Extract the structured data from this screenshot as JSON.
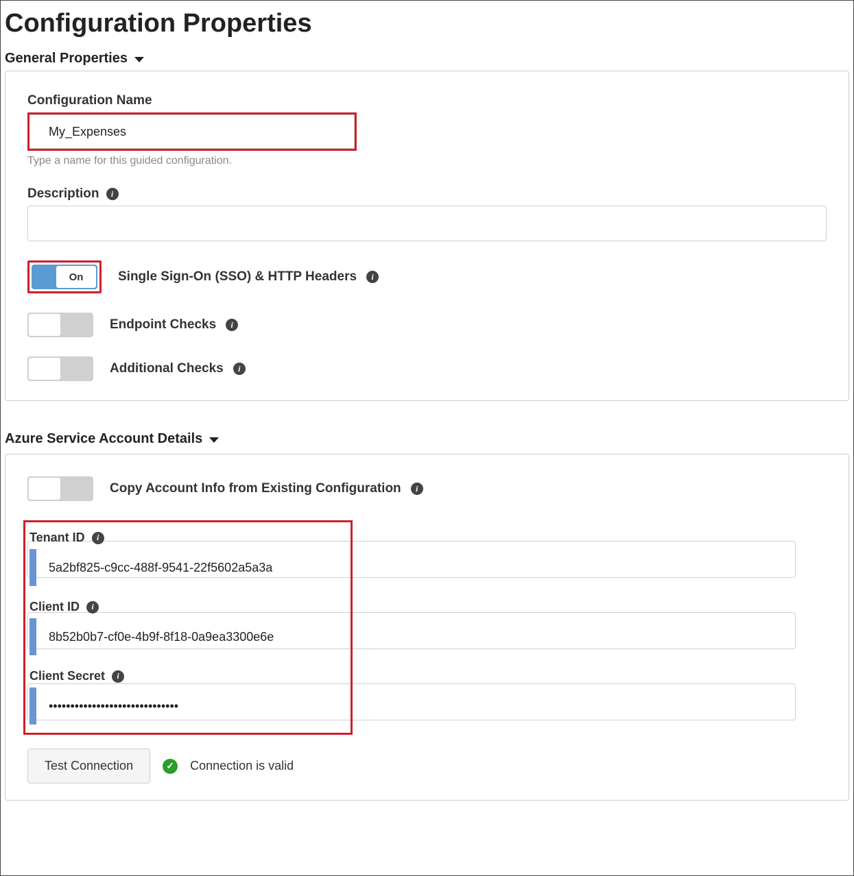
{
  "page_title": "Configuration Properties",
  "sections": {
    "general": {
      "header": "General Properties",
      "configuration_name": {
        "label": "Configuration Name",
        "value": "My_Expenses",
        "helper": "Type a name for this guided configuration."
      },
      "description": {
        "label": "Description",
        "value": ""
      },
      "toggles": {
        "sso": {
          "label": "Single Sign-On (SSO) & HTTP Headers",
          "state": "On",
          "on": true
        },
        "endpoint": {
          "label": "Endpoint Checks",
          "on": false
        },
        "additional": {
          "label": "Additional Checks",
          "on": false
        }
      }
    },
    "azure": {
      "header": "Azure Service Account Details",
      "copy_account": {
        "label": "Copy Account Info from Existing Configuration",
        "on": false
      },
      "tenant_id": {
        "label": "Tenant ID",
        "value": "5a2bf825-c9cc-488f-9541-22f5602a5a3a"
      },
      "client_id": {
        "label": "Client ID",
        "value": "8b52b0b7-cf0e-4b9f-8f18-0a9ea3300e6e"
      },
      "client_secret": {
        "label": "Client Secret",
        "value": "••••••••••••••••••••••••••••••"
      },
      "test_connection": {
        "button": "Test Connection",
        "status": "Connection is valid"
      }
    }
  }
}
